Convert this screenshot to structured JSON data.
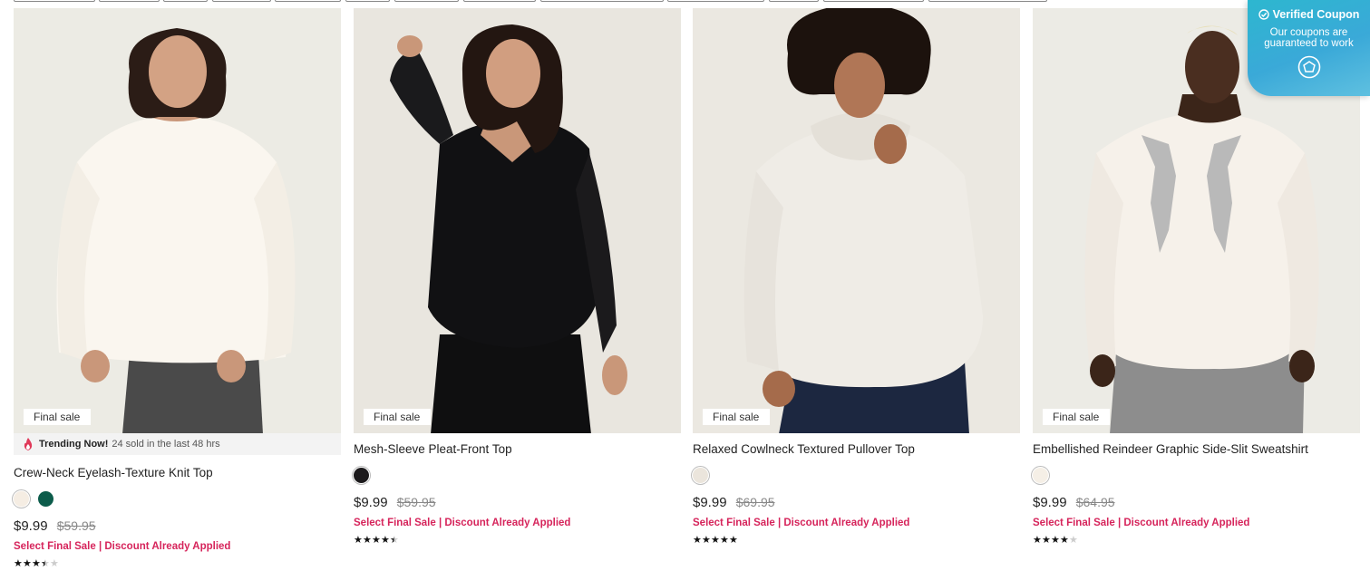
{
  "products": [
    {
      "badge": "Final sale",
      "trending": {
        "label": "Trending Now!",
        "text": "24 sold in the last 48 hrs"
      },
      "title": "Crew-Neck Eyelash-Texture Knit Top",
      "swatches": [
        "#f5ede3",
        "#0c5c4b"
      ],
      "price": "$9.99",
      "was": "$59.95",
      "promo": "Select Final Sale | Discount Already Applied",
      "rating": 3.5
    },
    {
      "badge": "Final sale",
      "title": "Mesh-Sleeve Pleat-Front Top",
      "swatches": [
        "#1c1a1c"
      ],
      "price": "$9.99",
      "was": "$59.95",
      "promo": "Select Final Sale | Discount Already Applied",
      "rating": 4.5
    },
    {
      "badge": "Final sale",
      "title": "Relaxed Cowlneck Textured Pullover Top",
      "swatches": [
        "#ebe5dc"
      ],
      "price": "$9.99",
      "was": "$69.95",
      "promo": "Select Final Sale | Discount Already Applied",
      "rating": 5
    },
    {
      "badge": "Final sale",
      "title": "Embellished Reindeer Graphic Side-Slit Sweatshirt",
      "swatches": [
        "#f5efe6"
      ],
      "price": "$9.99",
      "was": "$64.95",
      "promo": "Select Final Sale | Discount Already Applied",
      "rating": 4
    }
  ],
  "coupon": {
    "title": "Verified Coupon",
    "text": "Our coupons are guaranteed to work",
    "icon": "coupon-logo-icon"
  },
  "colors": {
    "promo": "#d6245b",
    "coupon": "#2db7cf"
  }
}
